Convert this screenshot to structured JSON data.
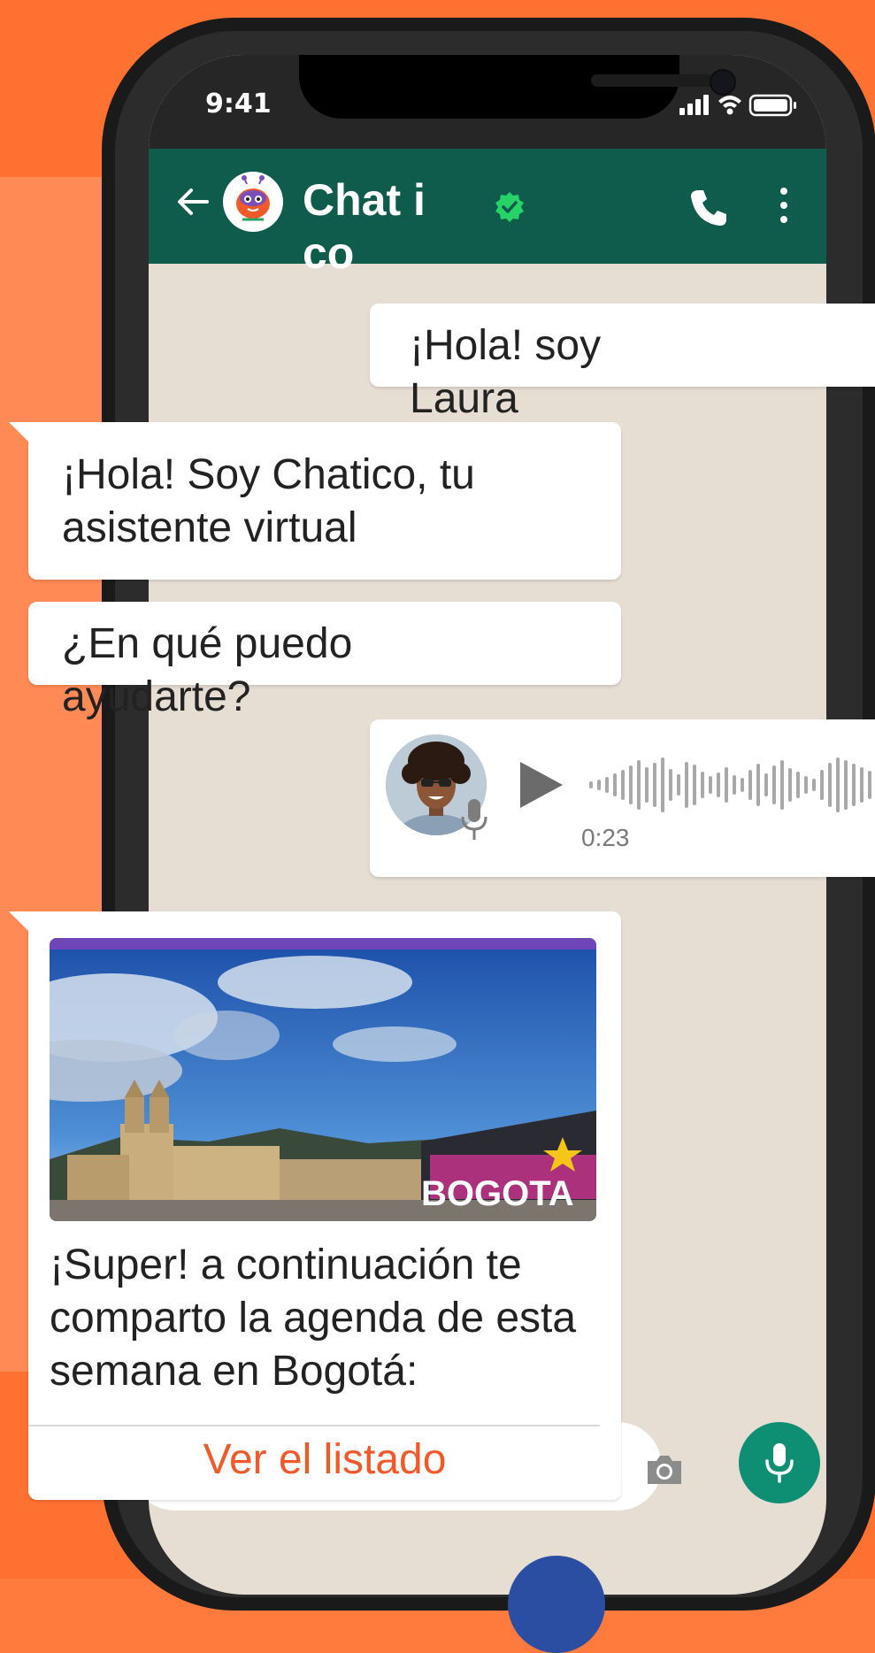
{
  "status": {
    "time": "9:41"
  },
  "header": {
    "title": "Chat ico"
  },
  "messages": {
    "out1": "¡Hola! soy Laura",
    "in1": "¡Hola! Soy Chatico, tu asistente virtual",
    "in2": "¿En qué puedo ayudarte?",
    "voice": {
      "duration": "0:23"
    },
    "card": {
      "text": "¡Super! a continuación te comparto la agenda de esta semana en Bogotá:",
      "brand": "BOGOTA",
      "link": "Ver el listado"
    }
  },
  "colors": {
    "background": "#ff7130",
    "header": "#0f5b4c",
    "chat_bg": "#e6ddd3",
    "accent": "#f0592a",
    "mic": "#0e8f74",
    "verified": "#25d366"
  },
  "icons": [
    "back-arrow-icon",
    "verified-badge-icon",
    "phone-icon",
    "more-vertical-icon",
    "play-icon",
    "mic-icon",
    "camera-icon",
    "signal-icon",
    "wifi-icon",
    "battery-icon"
  ]
}
